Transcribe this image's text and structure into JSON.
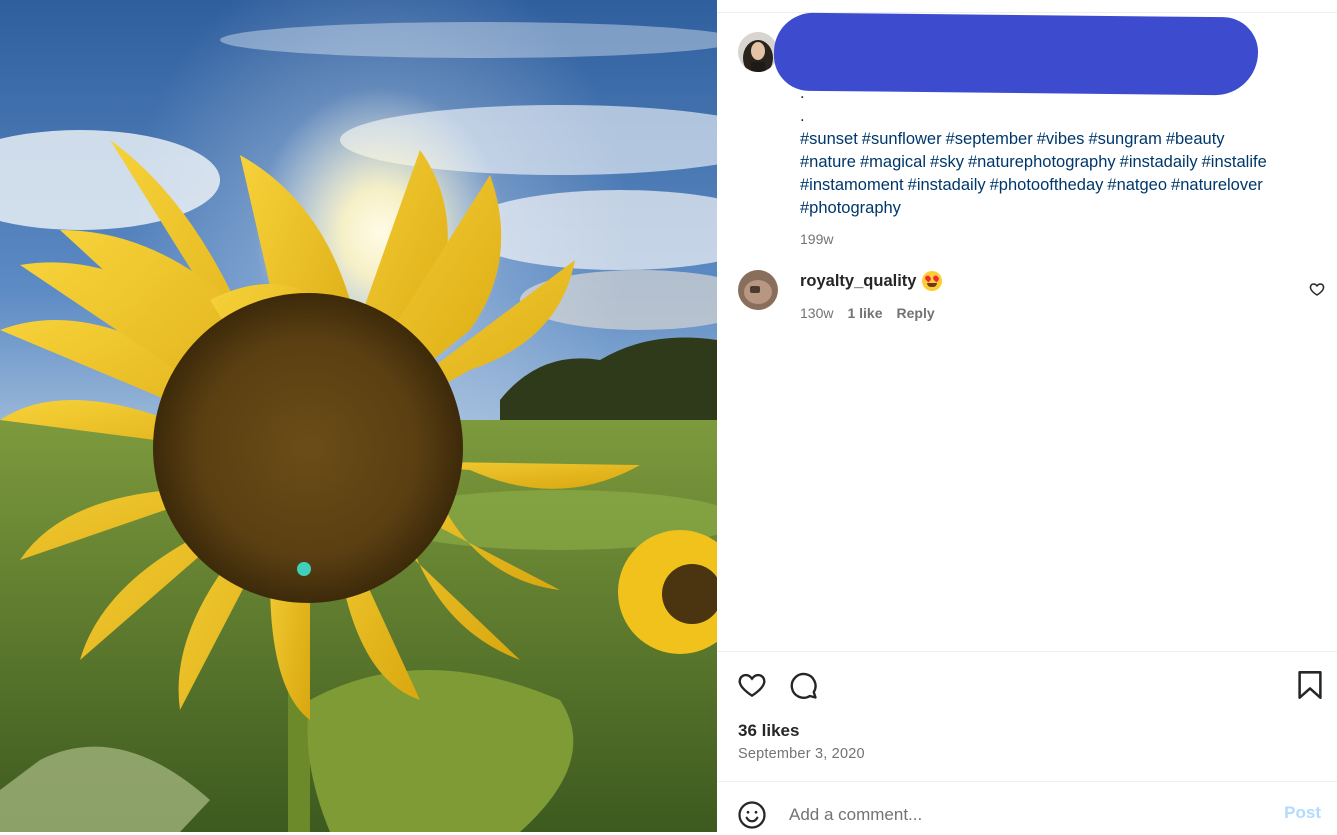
{
  "post": {
    "caption_dots": [
      ".",
      "."
    ],
    "hashtags": [
      "#sunset",
      "#sunflower",
      "#september",
      "#vibes",
      "#sungram",
      "#beauty",
      "#nature",
      "#magical",
      "#sky",
      "#naturephotography",
      "#instadaily",
      "#instalife",
      "#instamoment",
      "#instadaily",
      "#photooftheday",
      "#natgeo",
      "#naturelover",
      "#photography"
    ],
    "age": "199w"
  },
  "comment": {
    "username": "royalty_quality",
    "emoji": "heart-eyes-emoji",
    "age": "130w",
    "likes": "1 like",
    "reply": "Reply"
  },
  "icons": {
    "like": "heart-icon",
    "comment": "comment-bubble-icon",
    "save": "bookmark-icon",
    "emoji_picker": "smiley-icon",
    "comment_like": "small-heart-icon"
  },
  "footer": {
    "likes": "36 likes",
    "date": "September 3, 2020",
    "comment_placeholder": "Add a comment...",
    "post_label": "Post"
  },
  "colors": {
    "link": "#00376b",
    "muted": "#737373",
    "redaction": "#3d4bcf",
    "post_disabled": "#b3dbff"
  }
}
